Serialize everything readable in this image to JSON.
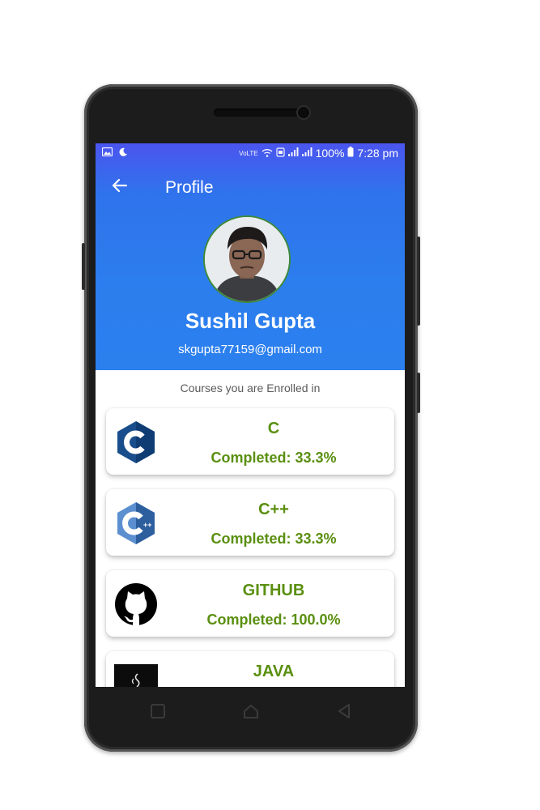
{
  "status_bar": {
    "left_icons": [
      "image-icon",
      "moon-icon"
    ],
    "network": "VoLTE",
    "battery": "100%",
    "time": "7:28 pm"
  },
  "toolbar": {
    "back_icon": "arrow-back-icon",
    "title": "Profile"
  },
  "profile": {
    "name": "Sushil Gupta",
    "email": "skgupta77159@gmail.com"
  },
  "courses_heading": "Courses you are Enrolled in",
  "courses": [
    {
      "name": "C",
      "completed": "Completed: 33.3%",
      "logo": "c-language-logo"
    },
    {
      "name": "C++",
      "completed": "Completed: 33.3%",
      "logo": "cpp-language-logo"
    },
    {
      "name": "GITHUB",
      "completed": "Completed: 100.0%",
      "logo": "github-logo"
    },
    {
      "name": "JAVA",
      "completed": "",
      "logo": "java-logo"
    }
  ],
  "nav_bar": [
    "recent-apps-button",
    "home-button",
    "back-button"
  ],
  "colors": {
    "header_top": "#4b55ef",
    "header_bottom": "#2b80ee",
    "course_text": "#5a8f10"
  }
}
